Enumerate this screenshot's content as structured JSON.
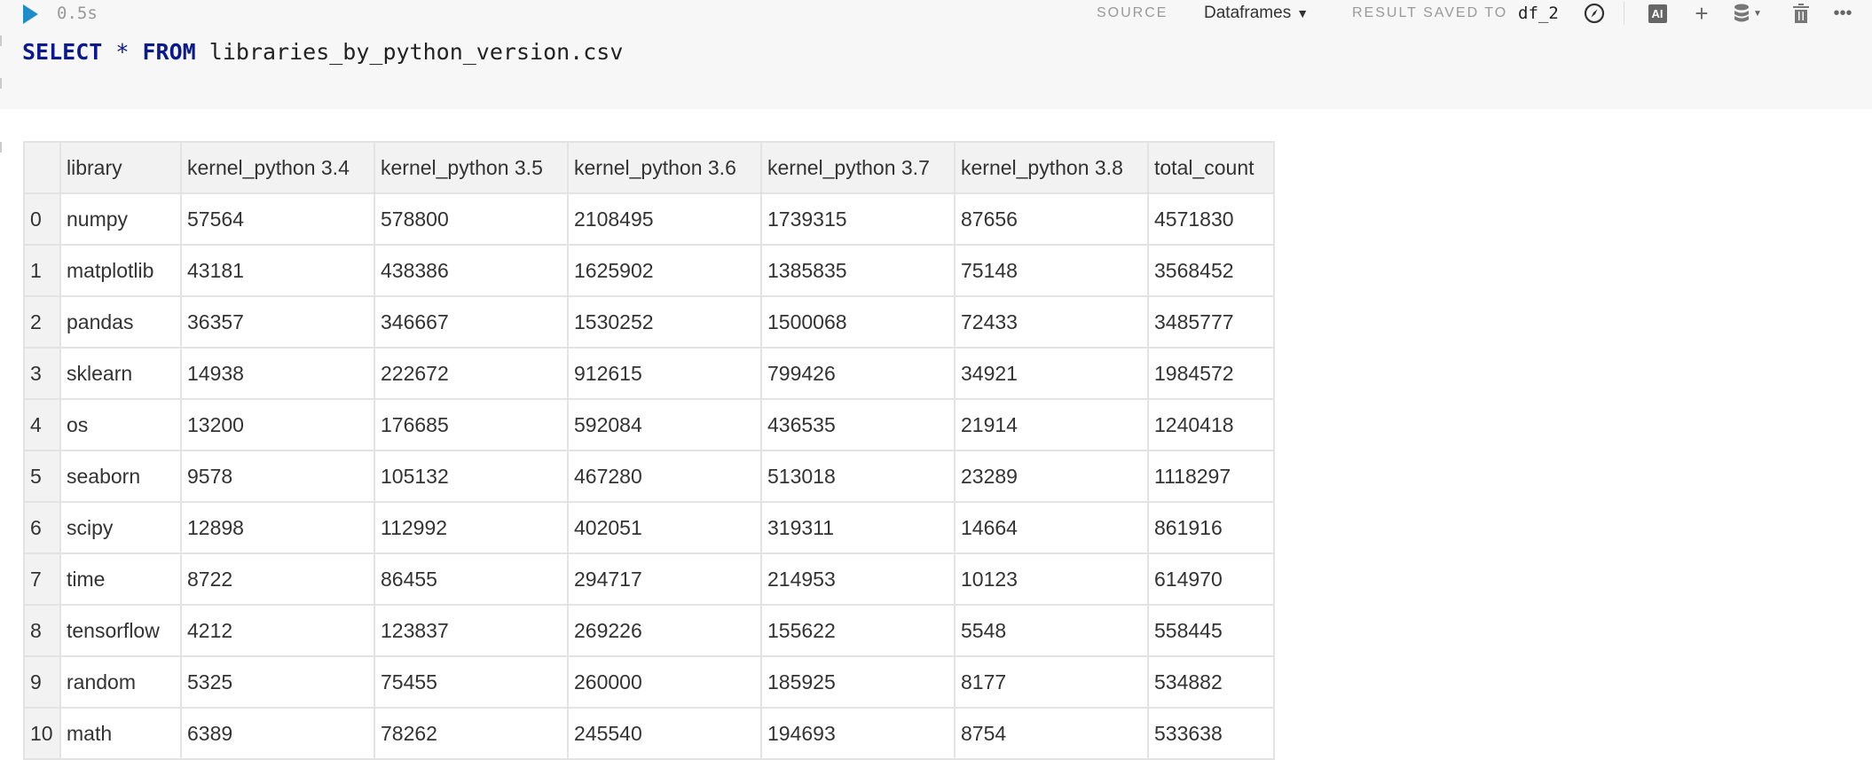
{
  "cell": {
    "exec_time": "0.5s",
    "sql": {
      "select": "SELECT",
      "star": "*",
      "from": "FROM",
      "table": "libraries_by_python_version.csv"
    }
  },
  "toolbar": {
    "source_label": "SOURCE",
    "source_value": "Dataframes",
    "result_label": "RESULT SAVED TO",
    "result_var": "df_2",
    "ai_label": "AI"
  },
  "table": {
    "columns": [
      "",
      "library",
      "kernel_python 3.4",
      "kernel_python 3.5",
      "kernel_python 3.6",
      "kernel_python 3.7",
      "kernel_python 3.8",
      "total_count"
    ],
    "rows": [
      [
        "0",
        "numpy",
        "57564",
        "578800",
        "2108495",
        "1739315",
        "87656",
        "4571830"
      ],
      [
        "1",
        "matplotlib",
        "43181",
        "438386",
        "1625902",
        "1385835",
        "75148",
        "3568452"
      ],
      [
        "2",
        "pandas",
        "36357",
        "346667",
        "1530252",
        "1500068",
        "72433",
        "3485777"
      ],
      [
        "3",
        "sklearn",
        "14938",
        "222672",
        "912615",
        "799426",
        "34921",
        "1984572"
      ],
      [
        "4",
        "os",
        "13200",
        "176685",
        "592084",
        "436535",
        "21914",
        "1240418"
      ],
      [
        "5",
        "seaborn",
        "9578",
        "105132",
        "467280",
        "513018",
        "23289",
        "1118297"
      ],
      [
        "6",
        "scipy",
        "12898",
        "112992",
        "402051",
        "319311",
        "14664",
        "861916"
      ],
      [
        "7",
        "time",
        "8722",
        "86455",
        "294717",
        "214953",
        "10123",
        "614970"
      ],
      [
        "8",
        "tensorflow",
        "4212",
        "123837",
        "269226",
        "155622",
        "5548",
        "558445"
      ],
      [
        "9",
        "random",
        "5325",
        "75455",
        "260000",
        "185925",
        "8177",
        "534882"
      ],
      [
        "10",
        "math",
        "6389",
        "78262",
        "245540",
        "194693",
        "8754",
        "533638"
      ]
    ]
  }
}
